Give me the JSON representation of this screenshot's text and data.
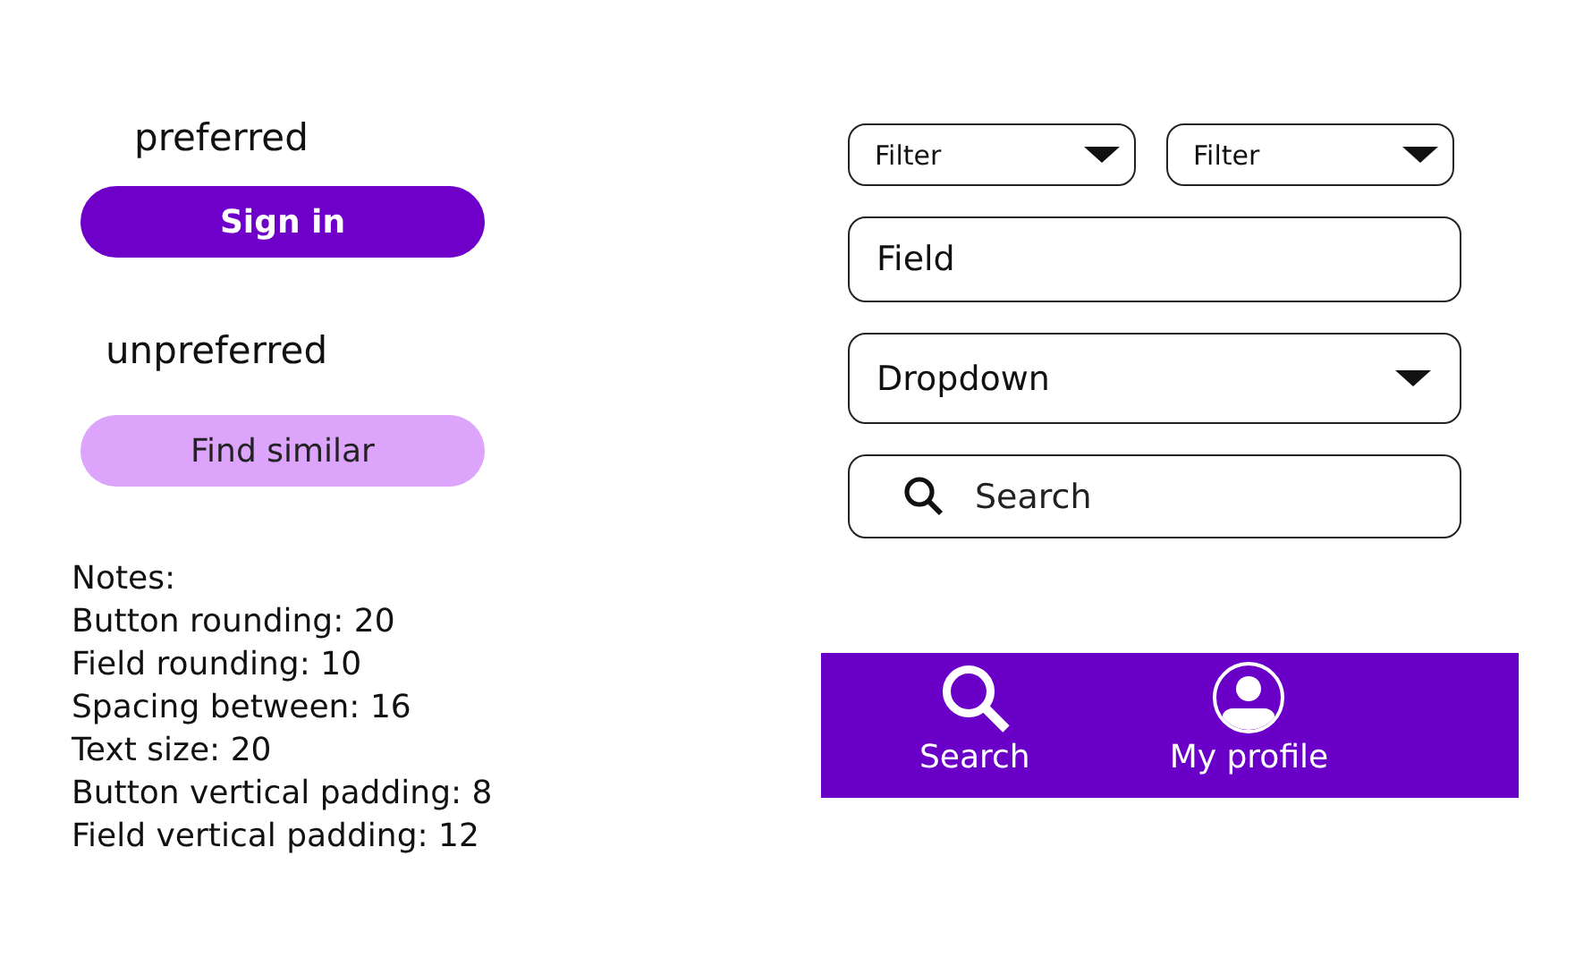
{
  "left": {
    "preferred_label": "preferred",
    "primary_button": {
      "label": "Sign in",
      "kind": "primary"
    },
    "unpreferred_label": "unpreferred",
    "secondary_button": {
      "label": "Find similar",
      "kind": "secondary"
    },
    "notes": [
      "Notes:",
      "Button rounding: 20",
      "Field rounding: 10",
      "Spacing between: 16",
      "Text size: 20",
      "Button vertical padding: 8",
      "Field vertical padding: 12"
    ]
  },
  "right": {
    "filters": [
      "Filter",
      "Filter"
    ],
    "field": {
      "value": "Field"
    },
    "dropdown": {
      "value": "Dropdown"
    },
    "search": {
      "placeholder": "Search"
    },
    "nav": [
      {
        "label": "Search",
        "kind": "search"
      },
      {
        "label": "My profile",
        "kind": "profile"
      }
    ]
  }
}
